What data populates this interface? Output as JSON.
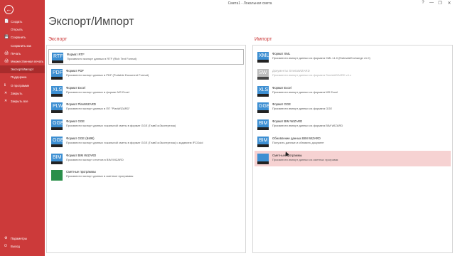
{
  "window": {
    "title": "Смета1 - Локальная смета",
    "help": "?",
    "minimize": "—",
    "restore": "❐",
    "close": "✕"
  },
  "sidebar": {
    "back_glyph": "←",
    "items": [
      {
        "label": "Создать",
        "icon": "📄"
      },
      {
        "label": "Открыть",
        "icon": ""
      },
      {
        "label": "Сохранить",
        "icon": "💾"
      },
      {
        "label": "Сохранить как",
        "icon": ""
      },
      {
        "label": "Печать",
        "icon": "🖨"
      },
      {
        "label": "Множественная печать",
        "icon": "🖨"
      },
      {
        "label": "Экспорт/Импорт",
        "icon": ""
      },
      {
        "label": "Поддержка",
        "icon": ""
      },
      {
        "label": "О программе",
        "icon": "ℹ"
      },
      {
        "label": "Закрыть",
        "icon": "✕"
      },
      {
        "label": "Закрыть все",
        "icon": "✕"
      }
    ],
    "bottom": [
      {
        "label": "Параметры",
        "icon": "⚙"
      },
      {
        "label": "Выход",
        "icon": "⏻"
      }
    ]
  },
  "page_title": "Экспорт/Импорт",
  "export": {
    "title": "Экспорт",
    "items": [
      {
        "title": "Формат RTF",
        "desc": "Произвести экспорт данных в RTF (Rich Text Format)",
        "badge": "RTF"
      },
      {
        "title": "Формат PDF",
        "desc": "Произвести экспорт данных в PDF (Portable Document Format)",
        "badge": "PDF"
      },
      {
        "title": "Формат Excel",
        "desc": "Произвести экспорт данных в формат MS Excel",
        "badge": "XLS"
      },
      {
        "title": "Формат PlanWIZARD",
        "desc": "Произвести экспорт данных в ПП \"PlanWIZARD\"",
        "badge": "PLW"
      },
      {
        "title": "Формат GGE",
        "desc": "Произвести экспорт данных локальной сметы в формат GGE (ГлавГосЭкспертиза)",
        "badge": "GGE"
      },
      {
        "title": "Формат GGE (БИМ)",
        "desc": "Произвести экспорт данных локальной сметы в формат GGE (ГлавГосЭкспертиза) с заданием IFCGuid",
        "badge": "GGE"
      },
      {
        "title": "Формат BIM WIZARD",
        "desc": "Произвести экспорт отчетов в BIM WIZARD",
        "badge": "BIM"
      },
      {
        "title": "Сметные программы",
        "desc": "Произвести экспорт данных в сметные программы",
        "badge": ""
      }
    ]
  },
  "import": {
    "title": "Импорт",
    "items": [
      {
        "title": "Формат XML",
        "desc": "Произвести импорт данных из формата XML v1.0 (EstimateExchange v1.0)",
        "badge": "XML"
      },
      {
        "title": "Документы SmetaWIZARD",
        "desc": "Произвести импорт данных из формата SmetaWIZARD v4.x",
        "badge": "SW"
      },
      {
        "title": "Формат Excel",
        "desc": "Произвести импорт данных из формата MS Excel",
        "badge": "XLS"
      },
      {
        "title": "Формат GGE",
        "desc": "Произвести импорт данных из формата GGE",
        "badge": "GGE"
      },
      {
        "title": "Формат BIM WIZARD",
        "desc": "Произвести импорт данных из формата BIM WIZARD",
        "badge": "BIM"
      },
      {
        "title": "Обновление данных BIM WIZARD",
        "desc": "Получить данные и обновить документ",
        "badge": "BIM"
      },
      {
        "title": "Сметные программы",
        "desc": "Произвести импорт данных из сметных программ",
        "badge": ""
      }
    ]
  }
}
